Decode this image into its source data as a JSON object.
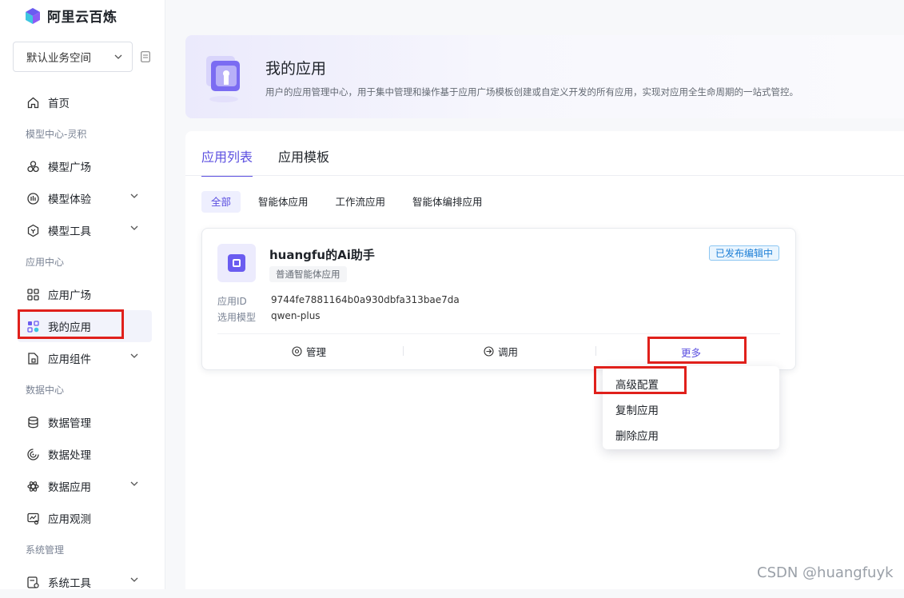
{
  "brand": {
    "name": "阿里云百炼"
  },
  "workspace": {
    "selected": "默认业务空间"
  },
  "nav": {
    "home": "首页",
    "section_model": "模型中心-灵积",
    "model_square": "模型广场",
    "model_experience": "模型体验",
    "model_tools": "模型工具",
    "section_app": "应用中心",
    "app_square": "应用广场",
    "my_apps": "我的应用",
    "app_components": "应用组件",
    "section_data": "数据中心",
    "data_manage": "数据管理",
    "data_process": "数据处理",
    "data_apps": "数据应用",
    "app_observe": "应用观测",
    "section_system": "系统管理",
    "system_tools": "系统工具"
  },
  "header": {
    "title": "我的应用",
    "description": "用户的应用管理中心，用于集中管理和操作基于应用广场模板创建或自定义开发的所有应用，实现对应用全生命周期的一站式管控。"
  },
  "tabs": [
    "应用列表",
    "应用模板"
  ],
  "filters": [
    "全部",
    "智能体应用",
    "工作流应用",
    "智能体编排应用"
  ],
  "app": {
    "name": "huangfu的Ai助手",
    "type": "普通智能体应用",
    "status": "已发布编辑中",
    "id_label": "应用ID",
    "id": "9744fe7881164b0a930dbfa313bae7da",
    "model_label": "选用模型",
    "model": "qwen-plus",
    "action_manage": "管理",
    "action_invoke": "调用",
    "action_more": "更多"
  },
  "more_menu": [
    "高级配置",
    "复制应用",
    "删除应用"
  ],
  "watermark": "CSDN @huangfuyk",
  "colors": {
    "accent": "#5b4fe0",
    "highlight_box": "#e0201b",
    "status_blue": "#1d7fd6"
  }
}
